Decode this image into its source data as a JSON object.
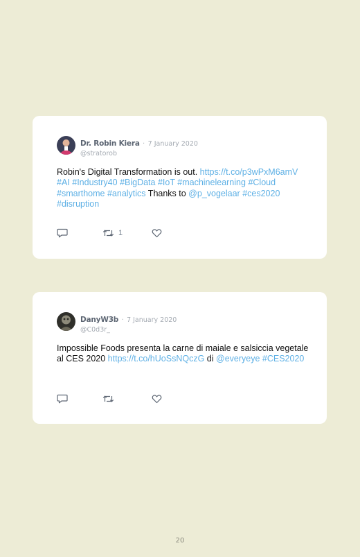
{
  "tweets": [
    {
      "display_name": "Dr. Robin Kiera",
      "separator": "·",
      "date": "7 January 2020",
      "handle": "@stratorob",
      "text_parts": [
        {
          "t": "Robin's Digital Transformation is out. ",
          "link": false
        },
        {
          "t": "https://t.co/p3wPxM6amV",
          "link": true
        },
        {
          "t": " ",
          "link": false
        },
        {
          "t": "#AI",
          "link": true
        },
        {
          "t": " ",
          "link": false
        },
        {
          "t": "#Industry40",
          "link": true
        },
        {
          "t": " ",
          "link": false
        },
        {
          "t": "#BigData",
          "link": true
        },
        {
          "t": " ",
          "link": false
        },
        {
          "t": "#IoT",
          "link": true
        },
        {
          "t": " ",
          "link": false
        },
        {
          "t": "#machinelearning",
          "link": true
        },
        {
          "t": " ",
          "link": false
        },
        {
          "t": "#Cloud",
          "link": true
        },
        {
          "t": " ",
          "link": false
        },
        {
          "t": "#smarthome",
          "link": true
        },
        {
          "t": " ",
          "link": false
        },
        {
          "t": "#analytics",
          "link": true
        },
        {
          "t": " Thanks to ",
          "link": false
        },
        {
          "t": "@p_vogelaar",
          "link": true
        },
        {
          "t": " ",
          "link": false
        },
        {
          "t": "#ces2020",
          "link": true
        },
        {
          "t": " ",
          "link": false
        },
        {
          "t": "#disruption",
          "link": true
        }
      ],
      "retweet_count": "1",
      "icons": [
        "reply-icon",
        "retweet-icon",
        "like-icon"
      ]
    },
    {
      "display_name": "DanyW3b",
      "separator": "·",
      "date": "7 January 2020",
      "handle": "@C0d3r_",
      "text_parts": [
        {
          "t": "Impossible Foods presenta la carne di maiale e salsiccia vegetale al CES 2020 ",
          "link": false
        },
        {
          "t": "https://t.co/hUoSsNQczG",
          "link": true
        },
        {
          "t": " di ",
          "link": false
        },
        {
          "t": "@everyeye",
          "link": true
        },
        {
          "t": " ",
          "link": false
        },
        {
          "t": "#CES2020",
          "link": true
        }
      ],
      "retweet_count": "",
      "icons": [
        "reply-icon",
        "retweet-icon",
        "like-icon"
      ]
    }
  ],
  "page_number": "20",
  "colors": {
    "background": "#edecd6",
    "card": "#ffffff",
    "link": "#5eb0e5",
    "muted": "#a4aab2",
    "name": "#5d6673"
  }
}
